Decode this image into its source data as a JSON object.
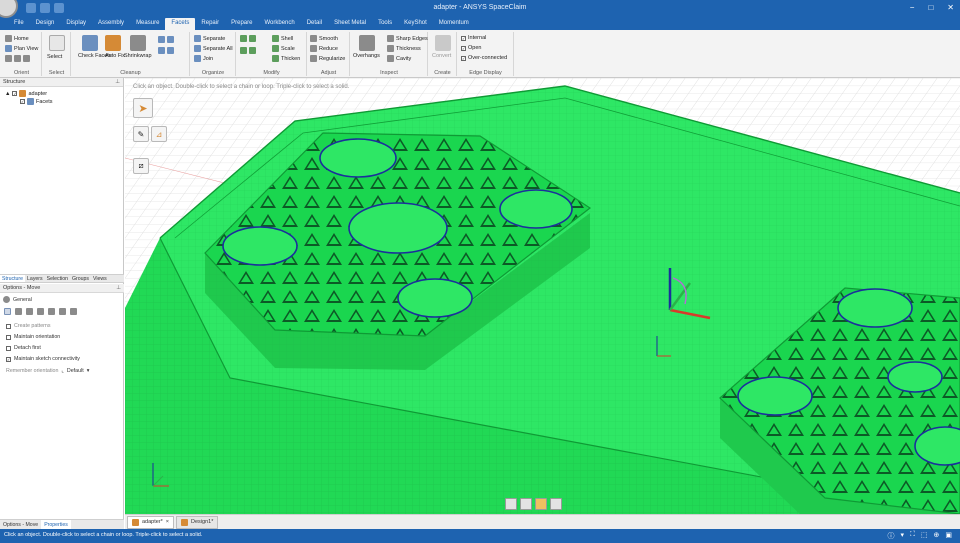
{
  "window": {
    "title": "adapter - ANSYS SpaceClaim",
    "controls": [
      "−",
      "□",
      "✕"
    ]
  },
  "ribbon_tabs": [
    "File",
    "Design",
    "Display",
    "Assembly",
    "Measure",
    "Facets",
    "Repair",
    "Prepare",
    "Workbench",
    "Detail",
    "Sheet Metal",
    "Tools",
    "KeyShot",
    "Momentum"
  ],
  "active_tab_index": 5,
  "ribbon": {
    "orient": {
      "label": "Orient",
      "home": "Home",
      "plan_view": "Plan View"
    },
    "select": {
      "label": "Select",
      "select": "Select"
    },
    "cleanup": {
      "label": "Cleanup",
      "check_facets": "Check Facets",
      "auto_fix": "Auto Fix",
      "shrinkwrap": "Shrinkwrap"
    },
    "organize": {
      "label": "Organize",
      "separate": "Separate",
      "separate_all": "Separate All",
      "join": "Join"
    },
    "modify": {
      "label": "Modify",
      "shell": "Shell",
      "scale": "Scale",
      "thicken": "Thicken"
    },
    "adjust": {
      "label": "Adjust",
      "smooth": "Smooth",
      "reduce": "Reduce",
      "regularize": "Regularize"
    },
    "inspect": {
      "label": "Inspect",
      "overhangs": "Overhangs",
      "sharp_edges": "Sharp Edges",
      "thickness": "Thickness",
      "cavity": "Cavity"
    },
    "create": {
      "label": "Create",
      "convert": "Convert"
    },
    "edge_display": {
      "label": "Edge Display",
      "internal": "Internal",
      "open": "Open",
      "over_connected": "Over-connected"
    }
  },
  "structure": {
    "header": "Structure",
    "root": "adapter",
    "child": "Facets"
  },
  "panel_tabs": [
    "Structure",
    "Layers",
    "Selection",
    "Groups",
    "Views"
  ],
  "options": {
    "header": "Options - Move",
    "section": "General",
    "rows": [
      {
        "label": "Create patterns",
        "checked": false,
        "enabled": false
      },
      {
        "label": "Maintain orientation",
        "checked": false,
        "enabled": true
      },
      {
        "label": "Detach first",
        "checked": false,
        "enabled": true
      },
      {
        "label": "Maintain sketch connectivity",
        "checked": true,
        "enabled": true
      }
    ],
    "remember_orientation_label": "Remember orientation",
    "remember_orientation_value": "Default"
  },
  "bottom_tabs": [
    "Options - Move",
    "Properties"
  ],
  "viewport": {
    "hint": "Click an object. Double-click to select a chain or loop. Triple-click to select a solid."
  },
  "doc_tabs": [
    "adapter*",
    "Design1*"
  ],
  "status": {
    "text": "Click an object. Double-click to select a chain or loop. Triple-click to select a solid."
  },
  "colors": {
    "accent": "#1e63b0",
    "model_green": "#22e05a",
    "model_edge": "#0f9a35",
    "hole_outline": "#1b2f9c"
  }
}
